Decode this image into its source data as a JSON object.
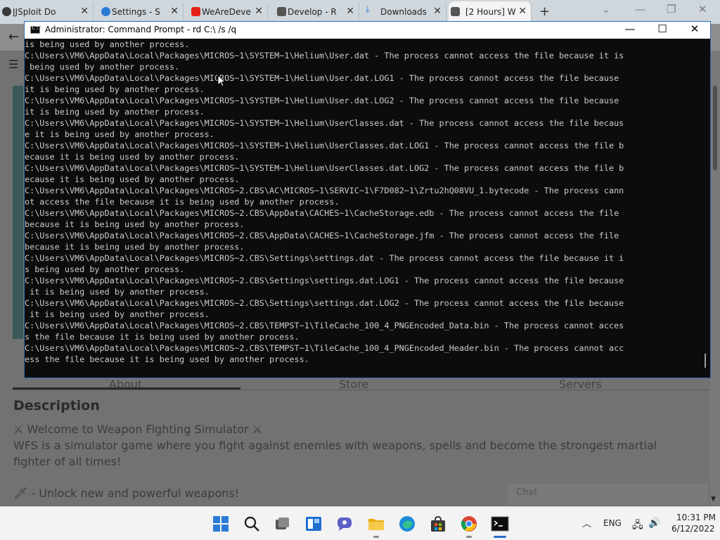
{
  "browser": {
    "tabs": [
      {
        "title": "JJSploit Do",
        "favicon_color": "#3a3a3a"
      },
      {
        "title": "Settings - S",
        "favicon_color": "#2b7bd6"
      },
      {
        "title": "WeAreDeve",
        "favicon_color": "#e62117"
      },
      {
        "title": "Develop - R",
        "favicon_color": "#555555"
      },
      {
        "title": "Downloads",
        "favicon_color": "#2b7bd6"
      },
      {
        "title": "[2 Hours] W",
        "favicon_color": "#555555"
      }
    ],
    "new_tab": "+",
    "tab_close": "✕",
    "back": "←",
    "menu": "☰"
  },
  "cmd": {
    "title": "Administrator: Command Prompt - rd  C:\\ /s /q",
    "icon_label": "C:\\",
    "controls": {
      "minimize": "—",
      "maximize": "☐",
      "close": "✕"
    },
    "lines": [
      "is being used by another process.",
      "C:\\Users\\VM6\\AppData\\Local\\Packages\\MICROS~1\\SYSTEM~1\\Helium\\User.dat - The process cannot access the file because it is",
      " being used by another process.",
      "C:\\Users\\VM6\\AppData\\Local\\Packages\\MICROS~1\\SYSTEM~1\\Helium\\User.dat.LOG1 - The process cannot access the file because",
      "it is being used by another process.",
      "C:\\Users\\VM6\\AppData\\Local\\Packages\\MICROS~1\\SYSTEM~1\\Helium\\User.dat.LOG2 - The process cannot access the file because",
      "it is being used by another process.",
      "C:\\Users\\VM6\\AppData\\Local\\Packages\\MICROS~1\\SYSTEM~1\\Helium\\UserClasses.dat - The process cannot access the file becaus",
      "e it is being used by another process.",
      "C:\\Users\\VM6\\AppData\\Local\\Packages\\MICROS~1\\SYSTEM~1\\Helium\\UserClasses.dat.LOG1 - The process cannot access the file b",
      "ecause it is being used by another process.",
      "C:\\Users\\VM6\\AppData\\Local\\Packages\\MICROS~1\\SYSTEM~1\\Helium\\UserClasses.dat.LOG2 - The process cannot access the file b",
      "ecause it is being used by another process.",
      "C:\\Users\\VM6\\AppData\\Local\\Packages\\MICROS~2.CBS\\AC\\MICROS~1\\SERVIC~1\\F7D082~1\\Zrtu2hQ08VU_1.bytecode - The process cann",
      "ot access the file because it is being used by another process.",
      "C:\\Users\\VM6\\AppData\\Local\\Packages\\MICROS~2.CBS\\AppData\\CACHES~1\\CacheStorage.edb - The process cannot access the file",
      "because it is being used by another process.",
      "C:\\Users\\VM6\\AppData\\Local\\Packages\\MICROS~2.CBS\\AppData\\CACHES~1\\CacheStorage.jfm - The process cannot access the file",
      "because it is being used by another process.",
      "C:\\Users\\VM6\\AppData\\Local\\Packages\\MICROS~2.CBS\\Settings\\settings.dat - The process cannot access the file because it i",
      "s being used by another process.",
      "C:\\Users\\VM6\\AppData\\Local\\Packages\\MICROS~2.CBS\\Settings\\settings.dat.LOG1 - The process cannot access the file because",
      " it is being used by another process.",
      "C:\\Users\\VM6\\AppData\\Local\\Packages\\MICROS~2.CBS\\Settings\\settings.dat.LOG2 - The process cannot access the file because",
      " it is being used by another process.",
      "C:\\Users\\VM6\\AppData\\Local\\Packages\\MICROS~2.CBS\\TEMPST~1\\TileCache_100_4_PNGEncoded_Data.bin - The process cannot acces",
      "s the file because it is being used by another process.",
      "C:\\Users\\VM6\\AppData\\Local\\Packages\\MICROS~2.CBS\\TEMPST~1\\TileCache_100_4_PNGEncoded_Header.bin - The process cannot acc",
      "ess the file because it is being used by another process."
    ]
  },
  "page": {
    "tabs": [
      "About",
      "Store",
      "Servers"
    ],
    "description_title": "Description",
    "description_lines": [
      "⚔ Welcome to Weapon Fighting Simulator ⚔",
      "WFS is a simulator game where you fight against enemies with weapons, spells and become the strongest martial",
      "fighter of all times!",
      "🗡 - Unlock new and powerful weapons!"
    ],
    "chat_label": "Chat"
  },
  "taskbar": {
    "apps": [
      "start",
      "search",
      "task-view",
      "widgets",
      "chat",
      "file-explorer",
      "edge",
      "store",
      "chrome",
      "command-prompt"
    ],
    "tray_language": "ENG",
    "time": "10:31 PM",
    "date": "6/12/2022"
  }
}
